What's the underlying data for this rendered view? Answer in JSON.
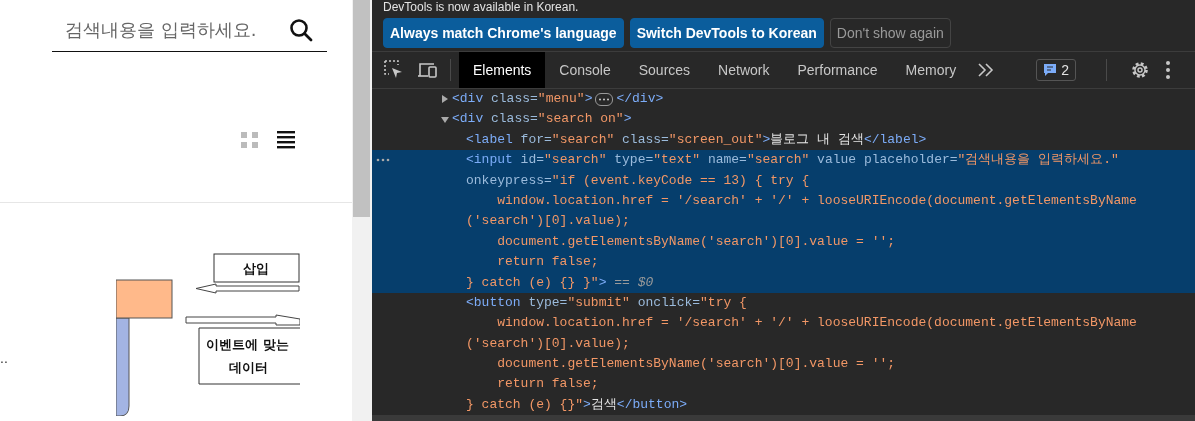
{
  "blog": {
    "search": {
      "placeholder": "검색내용을 입력하세요."
    },
    "view_toggle": [
      {
        "kind": "grid",
        "selected": false
      },
      {
        "kind": "list",
        "selected": true
      }
    ],
    "side_text": "..",
    "diagram": {
      "insert_label": "삽입",
      "data_label_lines": [
        "이벤트에 맞는",
        "데이터"
      ]
    }
  },
  "devtools": {
    "infobar": {
      "message": "DevTools is now available in Korean.",
      "buttons": [
        {
          "label": "Always match Chrome's language",
          "kind": "primary"
        },
        {
          "label": "Switch DevTools to Korean",
          "kind": "primary"
        },
        {
          "label": "Don't show again",
          "kind": "secondary"
        }
      ]
    },
    "tabs": [
      {
        "label": "Elements",
        "selected": true
      },
      {
        "label": "Console",
        "selected": false
      },
      {
        "label": "Sources",
        "selected": false
      },
      {
        "label": "Network",
        "selected": false
      },
      {
        "label": "Performance",
        "selected": false
      },
      {
        "label": "Memory",
        "selected": false
      }
    ],
    "issues_count": "2",
    "dom_tree": [
      {
        "expanded": false,
        "selected": false,
        "lines": [
          [
            {
              "kind": "tag",
              "text": "<div"
            },
            {
              "kind": "attr",
              "text": " class="
            },
            {
              "kind": "val",
              "text": "\"menu\""
            },
            {
              "kind": "tag",
              "text": ">"
            }
          ]
        ],
        "closing": [
          {
            "kind": "tag",
            "text": "</div>"
          }
        ]
      },
      {
        "expanded": true,
        "selected": false,
        "lines": [
          [
            {
              "kind": "tag",
              "text": "<div"
            },
            {
              "kind": "attr",
              "text": " class="
            },
            {
              "kind": "val",
              "text": "\"search on\""
            },
            {
              "kind": "tag",
              "text": ">"
            }
          ]
        ],
        "children": [
          {
            "selected": false,
            "lines": [
              [
                {
                  "kind": "tag",
                  "text": "<label"
                },
                {
                  "kind": "attr",
                  "text": " for="
                },
                {
                  "kind": "val",
                  "text": "\"search\""
                },
                {
                  "kind": "attr",
                  "text": " class="
                },
                {
                  "kind": "val",
                  "text": "\"screen_out\""
                },
                {
                  "kind": "tag",
                  "text": ">"
                },
                {
                  "kind": "txt",
                  "text": "블로그 내 검색"
                },
                {
                  "kind": "tag",
                  "text": "</label>"
                }
              ]
            ]
          },
          {
            "selected": true,
            "lines": [
              [
                {
                  "kind": "tag",
                  "text": "<input"
                },
                {
                  "kind": "attr",
                  "text": " id="
                },
                {
                  "kind": "val",
                  "text": "\"search\""
                },
                {
                  "kind": "attr",
                  "text": " type="
                },
                {
                  "kind": "val",
                  "text": "\"text\""
                },
                {
                  "kind": "attr",
                  "text": " name="
                },
                {
                  "kind": "val",
                  "text": "\"search\""
                },
                {
                  "kind": "attr",
                  "text": " value placeholder="
                },
                {
                  "kind": "val",
                  "text": "\"검색내용을 입력하세요.\""
                }
              ],
              [
                {
                  "kind": "attr",
                  "text": "onkeypress="
                },
                {
                  "kind": "val",
                  "text": "\"if (event.keyCode == 13) { try {"
                }
              ],
              [
                {
                  "kind": "val",
                  "text": "    window.location.href = '/search' + '/' + looseURIEncode(document.getElementsByName"
                }
              ],
              [
                {
                  "kind": "val",
                  "text": "('search')[0].value);"
                }
              ],
              [
                {
                  "kind": "val",
                  "text": "    document.getElementsByName('search')[0].value = '';"
                }
              ],
              [
                {
                  "kind": "val",
                  "text": "    return false;"
                }
              ],
              [
                {
                  "kind": "val",
                  "text": "} catch (e) {} }\""
                },
                {
                  "kind": "tag",
                  "text": ">"
                },
                {
                  "kind": "dim",
                  "text": " == $0"
                }
              ]
            ]
          },
          {
            "selected": false,
            "lines": [
              [
                {
                  "kind": "tag",
                  "text": "<button"
                },
                {
                  "kind": "attr",
                  "text": " type="
                },
                {
                  "kind": "val",
                  "text": "\"submit\""
                },
                {
                  "kind": "attr",
                  "text": " onclick="
                },
                {
                  "kind": "val",
                  "text": "\"try {"
                }
              ],
              [
                {
                  "kind": "val",
                  "text": "    window.location.href = '/search' + '/' + looseURIEncode(document.getElementsByName"
                }
              ],
              [
                {
                  "kind": "val",
                  "text": "('search')[0].value);"
                }
              ],
              [
                {
                  "kind": "val",
                  "text": "    document.getElementsByName('search')[0].value = '';"
                }
              ],
              [
                {
                  "kind": "val",
                  "text": "    return false;"
                }
              ],
              [
                {
                  "kind": "val",
                  "text": "} catch (e) {}\""
                },
                {
                  "kind": "tag",
                  "text": ">"
                },
                {
                  "kind": "txt",
                  "text": "검색"
                },
                {
                  "kind": "tag",
                  "text": "</button>"
                }
              ]
            ]
          }
        ]
      }
    ]
  }
}
